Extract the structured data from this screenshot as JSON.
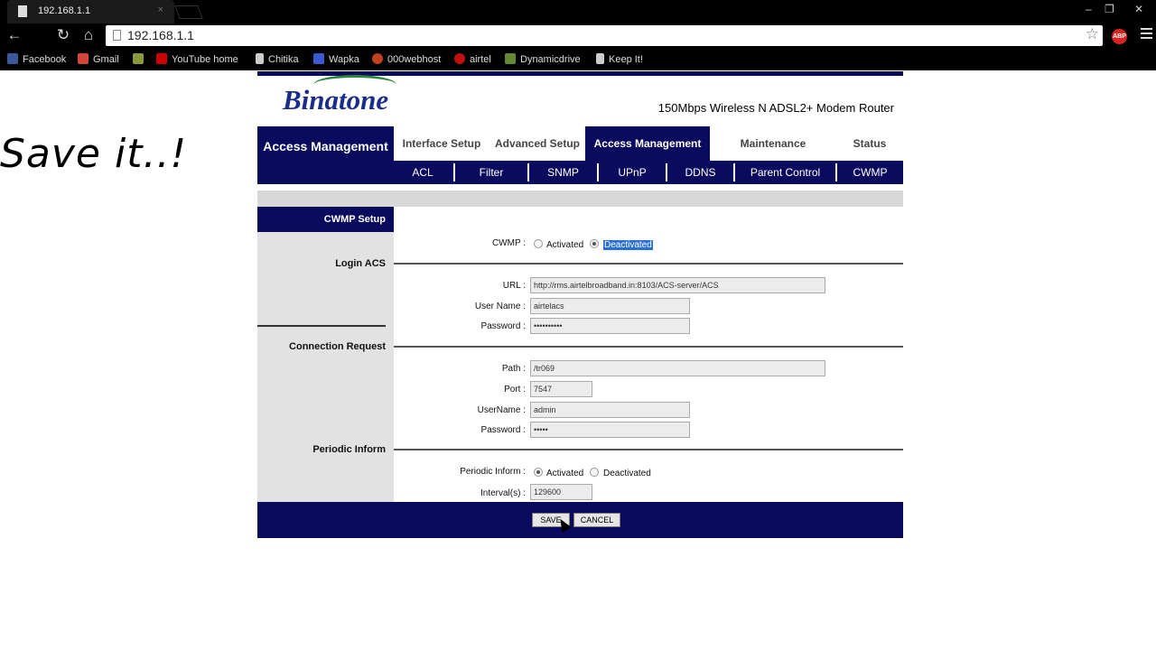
{
  "browser": {
    "tab_title": "192.168.1.1",
    "tab_close": "×",
    "window_controls": [
      "–",
      "❐",
      "✕"
    ],
    "back_glyph": "←",
    "reload_glyph": "↻",
    "home_glyph": "⌂",
    "url": "192.168.1.1",
    "star_glyph": "☆",
    "abp_label": "ABP"
  },
  "bookmarks": [
    {
      "label": "Facebook",
      "icon": "facebook-icon",
      "color": "#3b5998"
    },
    {
      "label": "Gmail",
      "icon": "gmail-icon",
      "color": "#d44638"
    },
    {
      "label": "",
      "icon": "image-icon",
      "color": "#8a9a3a"
    },
    {
      "label": "YouTube home",
      "icon": "youtube-icon",
      "color": "#cc0000"
    },
    {
      "label": "Chitika",
      "icon": "page-icon",
      "color": "#cccccc"
    },
    {
      "label": "Wapka",
      "icon": "wapka-icon",
      "color": "#3a5ad0"
    },
    {
      "label": "000webhost",
      "icon": "webhost-icon",
      "color": "#c04020"
    },
    {
      "label": "airtel",
      "icon": "airtel-icon",
      "color": "#c01010"
    },
    {
      "label": "Dynamicdrive",
      "icon": "dynamicdrive-icon",
      "color": "#668833"
    },
    {
      "label": "Keep It!",
      "icon": "page-icon",
      "color": "#cccccc"
    }
  ],
  "overlay_note": "Save it..!",
  "router": {
    "brand": "Binatone",
    "model": "150Mbps Wireless N ADSL2+ Modem Router",
    "nav_current": "Access Management",
    "nav_items": [
      {
        "label": "Interface Setup",
        "active": false
      },
      {
        "label": "Advanced Setup",
        "active": false
      },
      {
        "label": "Access Management",
        "active": true
      },
      {
        "label": "Maintenance",
        "active": false
      },
      {
        "label": "Status",
        "active": false
      }
    ],
    "sub_items": [
      "ACL",
      "Filter",
      "SNMP",
      "UPnP",
      "DDNS",
      "Parent Control",
      "CWMP"
    ],
    "section_header": "CWMP Setup",
    "cwmp": {
      "label": "CWMP :",
      "options": [
        "Activated",
        "Deactivated"
      ],
      "selected": "Deactivated"
    },
    "login_acs": {
      "title": "Login ACS",
      "url_label": "URL :",
      "url_value": "http://rms.airtelbroadband.in:8103/ACS-server/ACS",
      "username_label": "User Name :",
      "username_value": "airtelacs",
      "password_label": "Password :",
      "password_value": "••••••••••"
    },
    "connection_request": {
      "title": "Connection Request",
      "path_label": "Path :",
      "path_value": "/tr069",
      "port_label": "Port :",
      "port_value": "7547",
      "username_label": "UserName :",
      "username_value": "admin",
      "password_label": "Password :",
      "password_value": "•••••"
    },
    "periodic_inform": {
      "title": "Periodic Inform",
      "label": "Periodic Inform :",
      "options": [
        "Activated",
        "Deactivated"
      ],
      "selected": "Activated",
      "interval_label": "Interval(s) :",
      "interval_value": "129600"
    },
    "save_label": "SAVE",
    "cancel_label": "CANCEL"
  },
  "colors": {
    "nav_blue": "#0a0a5e",
    "brand_blue": "#1a2d8a",
    "selection": "#2a6fd6"
  }
}
